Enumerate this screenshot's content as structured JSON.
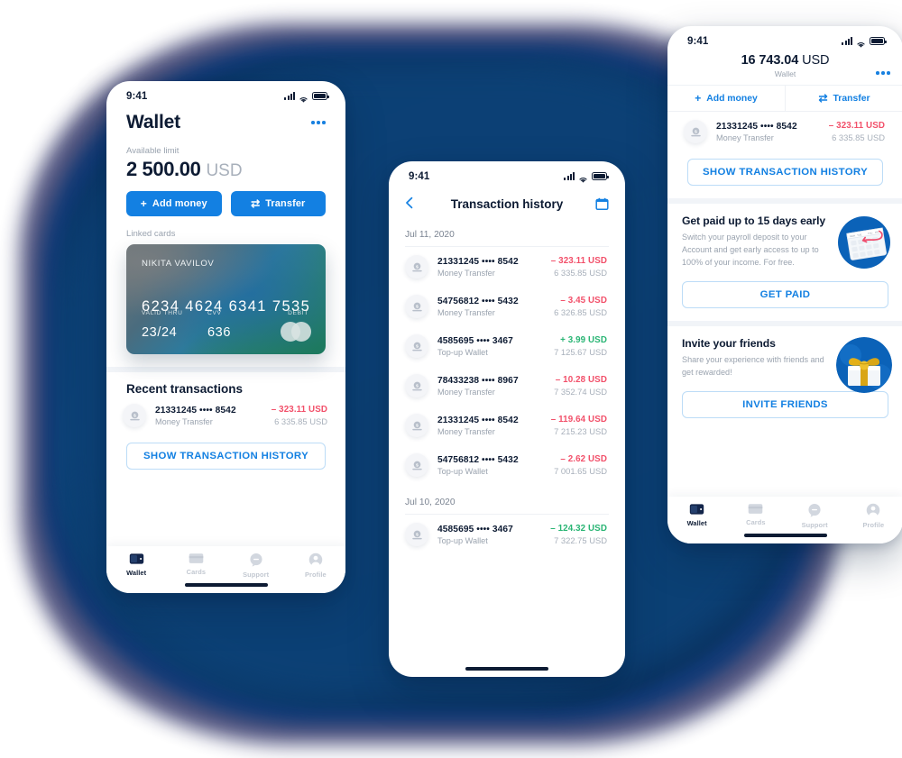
{
  "theme": {
    "accent": "#1380e2",
    "negative": "#f2506a",
    "positive": "#29b574",
    "dark": "#0d1b33",
    "muted": "#9aa3af",
    "blob": "#0c4176"
  },
  "status_bar": {
    "time": "9:41",
    "signal_icon": "signal-bars-icon",
    "wifi_icon": "wifi-icon",
    "battery_icon": "battery-icon"
  },
  "phone1": {
    "title": "Wallet",
    "menu_icon": "more-options-icon",
    "available_label": "Available limit",
    "balance_amount": "2 500.00",
    "balance_currency": "USD",
    "add_money_label": "Add money",
    "add_money_icon": "plus-icon",
    "transfer_label": "Transfer",
    "transfer_icon": "transfer-arrows-icon",
    "linked_cards_label": "Linked cards",
    "card": {
      "holder": "NIKITA VAVILOV",
      "number": "6234 4624 6341 7535",
      "valid_thru_label": "VALID THRU",
      "valid_thru": "23/24",
      "cvv_label": "CVV",
      "cvv": "636",
      "type_label": "DEBIT",
      "brand_icon": "mastercard-icon"
    },
    "recent_title": "Recent transactions",
    "transactions": [
      {
        "account": "21331245 •••• 8542",
        "type": "Money Transfer",
        "amount": "– 323.11 USD",
        "sign": "neg",
        "balance": "6 335.85  USD",
        "icon": "money-coin-icon"
      }
    ],
    "history_button": "SHOW TRANSACTION HISTORY"
  },
  "phone2": {
    "back_icon": "chevron-left-icon",
    "title": "Transaction history",
    "calendar_icon": "calendar-icon",
    "groups": [
      {
        "date": "Jul 11, 2020",
        "transactions": [
          {
            "account": "21331245 •••• 8542",
            "type": "Money Transfer",
            "amount": "– 323.11 USD",
            "sign": "neg",
            "balance": "6 335.85  USD",
            "icon": "money-coin-icon"
          },
          {
            "account": "54756812 •••• 5432",
            "type": "Money Transfer",
            "amount": "– 3.45 USD",
            "sign": "neg",
            "balance": "6 326.85  USD",
            "icon": "money-coin-icon"
          },
          {
            "account": "4585695 •••• 3467",
            "type": "Top-up Wallet",
            "amount": "+ 3.99 USD",
            "sign": "pos",
            "balance": "7 125.67  USD",
            "icon": "money-coin-icon"
          },
          {
            "account": "78433238 •••• 8967",
            "type": "Money Transfer",
            "amount": "– 10.28 USD",
            "sign": "neg",
            "balance": "7 352.74  USD",
            "icon": "money-coin-icon"
          },
          {
            "account": "21331245 •••• 8542",
            "type": "Money Transfer",
            "amount": "– 119.64 USD",
            "sign": "neg",
            "balance": "7 215.23  USD",
            "icon": "money-coin-icon"
          },
          {
            "account": "54756812 •••• 5432",
            "type": "Top-up Wallet",
            "amount": "– 2.62 USD",
            "sign": "neg",
            "balance": "7 001.65  USD",
            "icon": "money-coin-icon"
          }
        ]
      },
      {
        "date": "Jul 10, 2020",
        "transactions": [
          {
            "account": "4585695 •••• 3467",
            "type": "Top-up Wallet",
            "amount": "– 124.32 USD",
            "sign": "pos",
            "balance": "7 322.75  USD",
            "icon": "money-coin-icon"
          }
        ]
      }
    ]
  },
  "phone3": {
    "balance_amount": "16 743.04",
    "balance_currency": "USD",
    "subtitle": "Wallet",
    "menu_icon": "more-options-icon",
    "add_money_label": "Add money",
    "add_money_icon": "plus-icon",
    "transfer_label": "Transfer",
    "transfer_icon": "transfer-arrows-icon",
    "transactions": [
      {
        "account": "21331245 •••• 8542",
        "type": "Money Transfer",
        "amount": "– 323.11 USD",
        "sign": "neg",
        "balance": "6 335.85  USD",
        "icon": "money-coin-icon"
      }
    ],
    "history_button": "SHOW TRANSACTION HISTORY",
    "promo_payday": {
      "title": "Get paid up to 15 days early",
      "text": "Switch your payroll deposit to your Account and get early access to up to 100% of your income. For free.",
      "button": "GET PAID",
      "art_icon": "calendar-early-paycheck-icon"
    },
    "promo_invite": {
      "title": "Invite your friends",
      "text": "Share your experience with friends and get rewarded!",
      "button": "INVITE FRIENDS",
      "art_icon": "gift-box-icon"
    }
  },
  "tabbar": {
    "items": [
      {
        "label": "Wallet",
        "icon": "wallet-icon",
        "active": true
      },
      {
        "label": "Cards",
        "icon": "card-icon",
        "active": false
      },
      {
        "label": "Support",
        "icon": "chat-icon",
        "active": false
      },
      {
        "label": "Profile",
        "icon": "person-icon",
        "active": false
      }
    ]
  }
}
